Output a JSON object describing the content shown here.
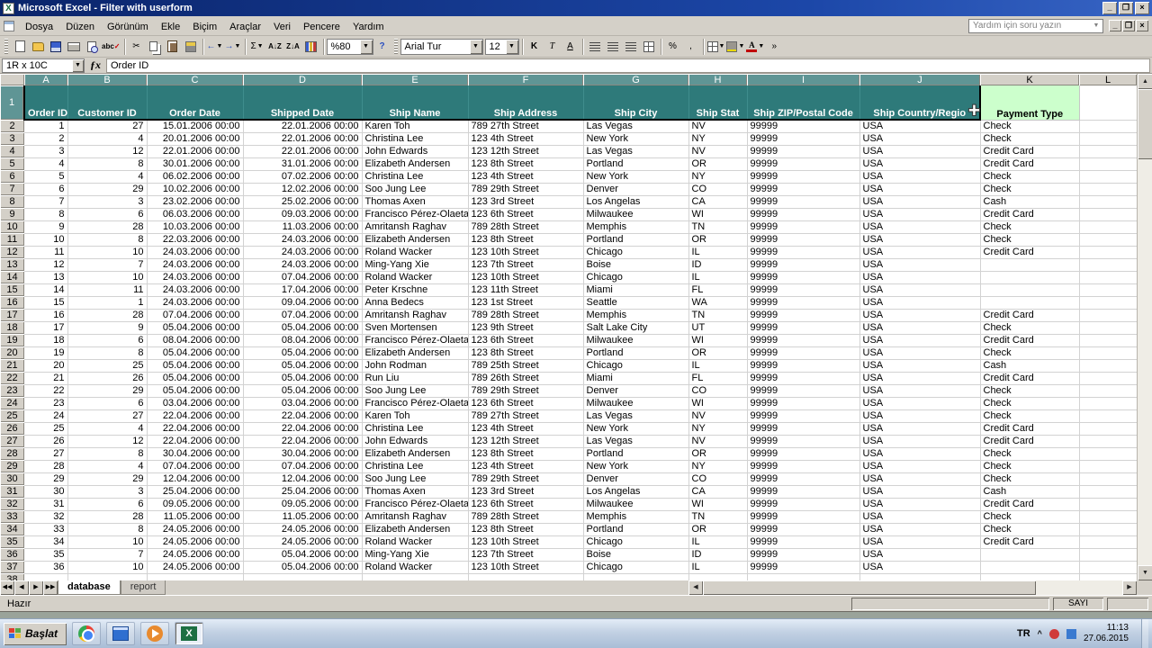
{
  "window": {
    "title": "Microsoft Excel - Filter with userform"
  },
  "menu": {
    "items": [
      "Dosya",
      "Düzen",
      "Görünüm",
      "Ekle",
      "Biçim",
      "Araçlar",
      "Veri",
      "Pencere",
      "Yardım"
    ],
    "help_box": "Yardım için soru yazın"
  },
  "toolbar": {
    "zoom": "%80",
    "font_name": "Arial Tur",
    "font_size": "12",
    "bold": "K",
    "italic": "T",
    "underline": "A",
    "sum": "Σ",
    "sort_asc": "A↓Z",
    "sort_desc": "Z↓A",
    "spell": "abc",
    "percent": "%",
    "comma": ",",
    "help": "?"
  },
  "formula_bar": {
    "name_box": "1R x 10C",
    "content": "Order ID"
  },
  "sheet": {
    "col_letters": [
      "A",
      "B",
      "C",
      "D",
      "E",
      "F",
      "G",
      "H",
      "I",
      "J",
      "K",
      "L"
    ],
    "headers": [
      "Order ID",
      "Customer ID",
      "Order Date",
      "Shipped Date",
      "Ship Name",
      "Ship Address",
      "Ship City",
      "Ship Stat",
      "Ship ZIP/Postal Code",
      "Ship Country/Regio",
      "Payment Type"
    ],
    "rows": [
      [
        1,
        27,
        "15.01.2006 00:00",
        "22.01.2006 00:00",
        "Karen Toh",
        "789 27th Street",
        "Las Vegas",
        "NV",
        "99999",
        "USA",
        "Check"
      ],
      [
        2,
        4,
        "20.01.2006 00:00",
        "22.01.2006 00:00",
        "Christina Lee",
        "123 4th Street",
        "New York",
        "NY",
        "99999",
        "USA",
        "Check"
      ],
      [
        3,
        12,
        "22.01.2006 00:00",
        "22.01.2006 00:00",
        "John Edwards",
        "123 12th Street",
        "Las Vegas",
        "NV",
        "99999",
        "USA",
        "Credit Card"
      ],
      [
        4,
        8,
        "30.01.2006 00:00",
        "31.01.2006 00:00",
        "Elizabeth Andersen",
        "123 8th Street",
        "Portland",
        "OR",
        "99999",
        "USA",
        "Credit Card"
      ],
      [
        5,
        4,
        "06.02.2006 00:00",
        "07.02.2006 00:00",
        "Christina Lee",
        "123 4th Street",
        "New York",
        "NY",
        "99999",
        "USA",
        "Check"
      ],
      [
        6,
        29,
        "10.02.2006 00:00",
        "12.02.2006 00:00",
        "Soo Jung Lee",
        "789 29th Street",
        "Denver",
        "CO",
        "99999",
        "USA",
        "Check"
      ],
      [
        7,
        3,
        "23.02.2006 00:00",
        "25.02.2006 00:00",
        "Thomas Axen",
        "123 3rd Street",
        "Los Angelas",
        "CA",
        "99999",
        "USA",
        "Cash"
      ],
      [
        8,
        6,
        "06.03.2006 00:00",
        "09.03.2006 00:00",
        "Francisco Pérez-Olaeta",
        "123 6th Street",
        "Milwaukee",
        "WI",
        "99999",
        "USA",
        "Credit Card"
      ],
      [
        9,
        28,
        "10.03.2006 00:00",
        "11.03.2006 00:00",
        "Amritansh Raghav",
        "789 28th Street",
        "Memphis",
        "TN",
        "99999",
        "USA",
        "Check"
      ],
      [
        10,
        8,
        "22.03.2006 00:00",
        "24.03.2006 00:00",
        "Elizabeth Andersen",
        "123 8th Street",
        "Portland",
        "OR",
        "99999",
        "USA",
        "Check"
      ],
      [
        11,
        10,
        "24.03.2006 00:00",
        "24.03.2006 00:00",
        "Roland Wacker",
        "123 10th Street",
        "Chicago",
        "IL",
        "99999",
        "USA",
        "Credit Card"
      ],
      [
        12,
        7,
        "24.03.2006 00:00",
        "24.03.2006 00:00",
        "Ming-Yang Xie",
        "123 7th Street",
        "Boise",
        "ID",
        "99999",
        "USA",
        ""
      ],
      [
        13,
        10,
        "24.03.2006 00:00",
        "07.04.2006 00:00",
        "Roland Wacker",
        "123 10th Street",
        "Chicago",
        "IL",
        "99999",
        "USA",
        ""
      ],
      [
        14,
        11,
        "24.03.2006 00:00",
        "17.04.2006 00:00",
        "Peter Krschne",
        "123 11th Street",
        "Miami",
        "FL",
        "99999",
        "USA",
        ""
      ],
      [
        15,
        1,
        "24.03.2006 00:00",
        "09.04.2006 00:00",
        "Anna Bedecs",
        "123 1st Street",
        "Seattle",
        "WA",
        "99999",
        "USA",
        ""
      ],
      [
        16,
        28,
        "07.04.2006 00:00",
        "07.04.2006 00:00",
        "Amritansh Raghav",
        "789 28th Street",
        "Memphis",
        "TN",
        "99999",
        "USA",
        "Credit Card"
      ],
      [
        17,
        9,
        "05.04.2006 00:00",
        "05.04.2006 00:00",
        "Sven Mortensen",
        "123 9th Street",
        "Salt Lake City",
        "UT",
        "99999",
        "USA",
        "Check"
      ],
      [
        18,
        6,
        "08.04.2006 00:00",
        "08.04.2006 00:00",
        "Francisco Pérez-Olaeta",
        "123 6th Street",
        "Milwaukee",
        "WI",
        "99999",
        "USA",
        "Credit Card"
      ],
      [
        19,
        8,
        "05.04.2006 00:00",
        "05.04.2006 00:00",
        "Elizabeth Andersen",
        "123 8th Street",
        "Portland",
        "OR",
        "99999",
        "USA",
        "Check"
      ],
      [
        20,
        25,
        "05.04.2006 00:00",
        "05.04.2006 00:00",
        "John Rodman",
        "789 25th Street",
        "Chicago",
        "IL",
        "99999",
        "USA",
        "Cash"
      ],
      [
        21,
        26,
        "05.04.2006 00:00",
        "05.04.2006 00:00",
        "Run Liu",
        "789 26th Street",
        "Miami",
        "FL",
        "99999",
        "USA",
        "Credit Card"
      ],
      [
        22,
        29,
        "05.04.2006 00:00",
        "05.04.2006 00:00",
        "Soo Jung Lee",
        "789 29th Street",
        "Denver",
        "CO",
        "99999",
        "USA",
        "Check"
      ],
      [
        23,
        6,
        "03.04.2006 00:00",
        "03.04.2006 00:00",
        "Francisco Pérez-Olaeta",
        "123 6th Street",
        "Milwaukee",
        "WI",
        "99999",
        "USA",
        "Check"
      ],
      [
        24,
        27,
        "22.04.2006 00:00",
        "22.04.2006 00:00",
        "Karen Toh",
        "789 27th Street",
        "Las Vegas",
        "NV",
        "99999",
        "USA",
        "Check"
      ],
      [
        25,
        4,
        "22.04.2006 00:00",
        "22.04.2006 00:00",
        "Christina Lee",
        "123 4th Street",
        "New York",
        "NY",
        "99999",
        "USA",
        "Credit Card"
      ],
      [
        26,
        12,
        "22.04.2006 00:00",
        "22.04.2006 00:00",
        "John Edwards",
        "123 12th Street",
        "Las Vegas",
        "NV",
        "99999",
        "USA",
        "Credit Card"
      ],
      [
        27,
        8,
        "30.04.2006 00:00",
        "30.04.2006 00:00",
        "Elizabeth Andersen",
        "123 8th Street",
        "Portland",
        "OR",
        "99999",
        "USA",
        "Check"
      ],
      [
        28,
        4,
        "07.04.2006 00:00",
        "07.04.2006 00:00",
        "Christina Lee",
        "123 4th Street",
        "New York",
        "NY",
        "99999",
        "USA",
        "Check"
      ],
      [
        29,
        29,
        "12.04.2006 00:00",
        "12.04.2006 00:00",
        "Soo Jung Lee",
        "789 29th Street",
        "Denver",
        "CO",
        "99999",
        "USA",
        "Check"
      ],
      [
        30,
        3,
        "25.04.2006 00:00",
        "25.04.2006 00:00",
        "Thomas Axen",
        "123 3rd Street",
        "Los Angelas",
        "CA",
        "99999",
        "USA",
        "Cash"
      ],
      [
        31,
        6,
        "09.05.2006 00:00",
        "09.05.2006 00:00",
        "Francisco Pérez-Olaeta",
        "123 6th Street",
        "Milwaukee",
        "WI",
        "99999",
        "USA",
        "Credit Card"
      ],
      [
        32,
        28,
        "11.05.2006 00:00",
        "11.05.2006 00:00",
        "Amritansh Raghav",
        "789 28th Street",
        "Memphis",
        "TN",
        "99999",
        "USA",
        "Check"
      ],
      [
        33,
        8,
        "24.05.2006 00:00",
        "24.05.2006 00:00",
        "Elizabeth Andersen",
        "123 8th Street",
        "Portland",
        "OR",
        "99999",
        "USA",
        "Check"
      ],
      [
        34,
        10,
        "24.05.2006 00:00",
        "24.05.2006 00:00",
        "Roland Wacker",
        "123 10th Street",
        "Chicago",
        "IL",
        "99999",
        "USA",
        "Credit Card"
      ],
      [
        35,
        7,
        "24.05.2006 00:00",
        "05.04.2006 00:00",
        "Ming-Yang Xie",
        "123 7th Street",
        "Boise",
        "ID",
        "99999",
        "USA",
        ""
      ],
      [
        36,
        10,
        "24.05.2006 00:00",
        "05.04.2006 00:00",
        "Roland Wacker",
        "123 10th Street",
        "Chicago",
        "IL",
        "99999",
        "USA",
        ""
      ]
    ]
  },
  "tabs": {
    "sheet_tabs": [
      "database",
      "report"
    ]
  },
  "status_bar": {
    "left": "Hazır",
    "right": "SAYI"
  },
  "taskbar": {
    "start": "Başlat",
    "lang": "TR",
    "chevron": "^",
    "time": "11:13",
    "date": "27.06.2015"
  },
  "colors": {
    "selection_teal": "#2e7a7a",
    "header_green": "#ccffcc",
    "titlebar_blue": "#0a246a"
  }
}
